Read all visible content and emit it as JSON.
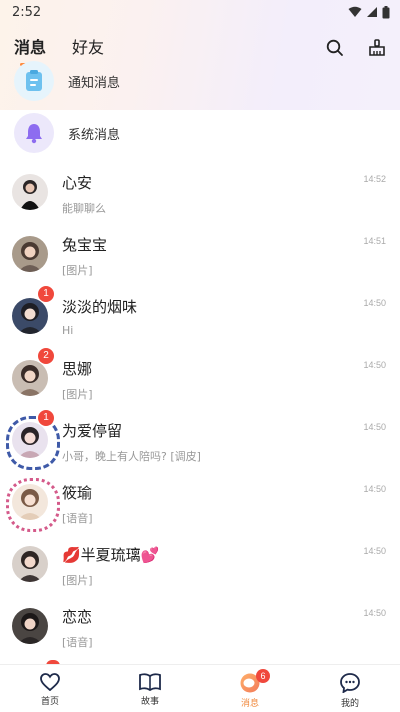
{
  "status_bar": {
    "time": "2:52"
  },
  "header": {
    "tabs": [
      {
        "label": "消息",
        "active": true
      },
      {
        "label": "好友",
        "active": false
      }
    ]
  },
  "system_items": [
    {
      "label": "通知消息",
      "icon": "clipboard-icon",
      "color": "#7ec8f0"
    },
    {
      "label": "系统消息",
      "icon": "bell-icon",
      "color": "#8d6cf0"
    }
  ],
  "chats": [
    {
      "name": "心安",
      "preview": "能聊聊么",
      "time": "14:52",
      "badge": ""
    },
    {
      "name": "兔宝宝",
      "preview": "[图片]",
      "time": "14:51",
      "badge": ""
    },
    {
      "name": "淡淡的烟味",
      "preview": "Hi",
      "time": "14:50",
      "badge": "1"
    },
    {
      "name": "思娜",
      "preview": "[图片]",
      "time": "14:50",
      "badge": "2"
    },
    {
      "name": "为爱停留",
      "preview": "小哥，晚上有人陪吗?  [调皮]",
      "time": "14:50",
      "badge": "1"
    },
    {
      "name": "筱瑜",
      "preview": "[语音]",
      "time": "14:50",
      "badge": ""
    },
    {
      "name": "💋半夏琉璃💕",
      "preview": "[图片]",
      "time": "14:50",
      "badge": ""
    },
    {
      "name": "恋恋",
      "preview": "[语音]",
      "time": "14:50",
      "badge": ""
    }
  ],
  "bottom_nav": [
    {
      "label": "首页",
      "icon": "heart-icon"
    },
    {
      "label": "故事",
      "icon": "book-icon"
    },
    {
      "label": "消息",
      "icon": "chat-bubble-icon",
      "badge": "6",
      "active": true
    },
    {
      "label": "我的",
      "icon": "smiley-chat-icon"
    }
  ],
  "colors": {
    "accent": "#f0883c",
    "badge": "#f0483c"
  }
}
